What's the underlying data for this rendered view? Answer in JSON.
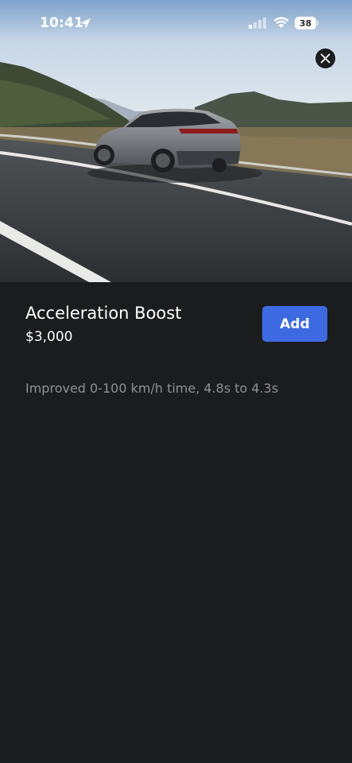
{
  "status_bar": {
    "time": "10:41",
    "battery_level": "38",
    "icons": [
      "location-arrow-icon",
      "cellular-signal-icon",
      "wifi-icon",
      "battery-icon"
    ]
  },
  "hero": {
    "image_icon": "car-photo",
    "close_icon": "close-icon"
  },
  "upgrade": {
    "title": "Acceleration Boost",
    "price": "$3,000",
    "add_label": "Add",
    "description": "Improved 0-100 km/h time, 4.8s to 4.3s"
  },
  "colors": {
    "background": "#1b1c1e",
    "accent": "#3e6ae1",
    "secondary_text": "#8f9194"
  }
}
